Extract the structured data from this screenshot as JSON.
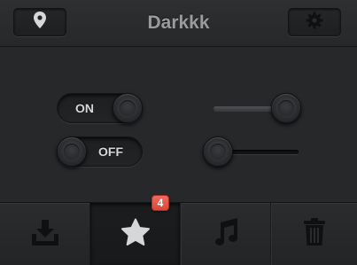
{
  "header": {
    "title": "Darkkk",
    "left_icon": "location-pin-icon",
    "right_icon": "gear-icon"
  },
  "toggles": [
    {
      "label": "ON",
      "state": "on"
    },
    {
      "label": "OFF",
      "state": "off"
    }
  ],
  "sliders": [
    {
      "value": 0.85
    },
    {
      "value": 0.05
    }
  ],
  "tabbar": {
    "active_tab": "favorites",
    "tabs": [
      {
        "icon": "download-icon"
      },
      {
        "icon": "star-icon",
        "badge": "4"
      },
      {
        "icon": "music-note-icon"
      },
      {
        "icon": "trash-icon"
      }
    ]
  },
  "colors": {
    "background": "#27282a",
    "badge": "#e05a4b",
    "text": "#9a9b9d"
  }
}
